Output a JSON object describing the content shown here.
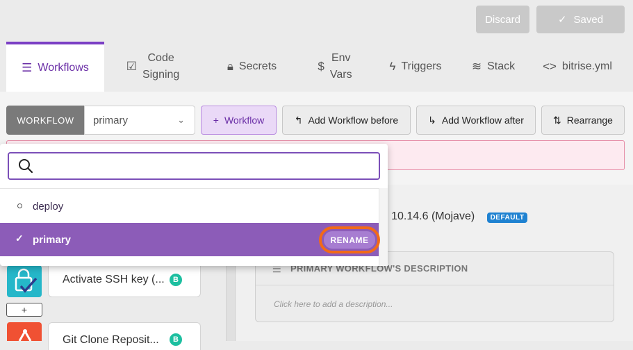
{
  "header": {
    "discard_label": "Discard",
    "saved_label": "Saved"
  },
  "tabs": [
    {
      "label": "Workflows",
      "icon": "list-icon",
      "active": true
    },
    {
      "label": "Code\nSigning",
      "icon": "edit-square-icon"
    },
    {
      "label": "Secrets",
      "icon": "lock-icon"
    },
    {
      "label": "Env\nVars",
      "icon": "dollar-icon"
    },
    {
      "label": "Triggers",
      "icon": "lightning-icon"
    },
    {
      "label": "Stack",
      "icon": "layers-icon"
    },
    {
      "label": "bitrise.yml",
      "icon": "code-icon"
    }
  ],
  "toolbar": {
    "workflow_label": "WORKFLOW",
    "selected_workflow": "primary",
    "add_workflow_label": "Workflow",
    "add_before_label": "Add Workflow before",
    "add_after_label": "Add Workflow after",
    "rearrange_label": "Rearrange"
  },
  "dropdown": {
    "search_placeholder": "",
    "items": [
      {
        "label": "deploy",
        "selected": false
      },
      {
        "label": "primary",
        "selected": true
      }
    ],
    "rename_label": "RENAME"
  },
  "steps": [
    {
      "label": "Activate SSH key (...",
      "badge": "B"
    },
    {
      "label": "Git Clone Reposit...",
      "badge": "B"
    }
  ],
  "add_step_label": "+",
  "workflow_info": {
    "stack_text": "S 10.14.6 (Mojave)",
    "default_badge": "DEFAULT",
    "description_title": "PRIMARY WORKFLOW'S DESCRIPTION",
    "description_placeholder": "Click here to add a description..."
  },
  "colors": {
    "accent": "#7b3fc4",
    "selected_item": "#8c5cb8",
    "highlight_ring": "#f26a18",
    "default_badge": "#1f82d1"
  }
}
